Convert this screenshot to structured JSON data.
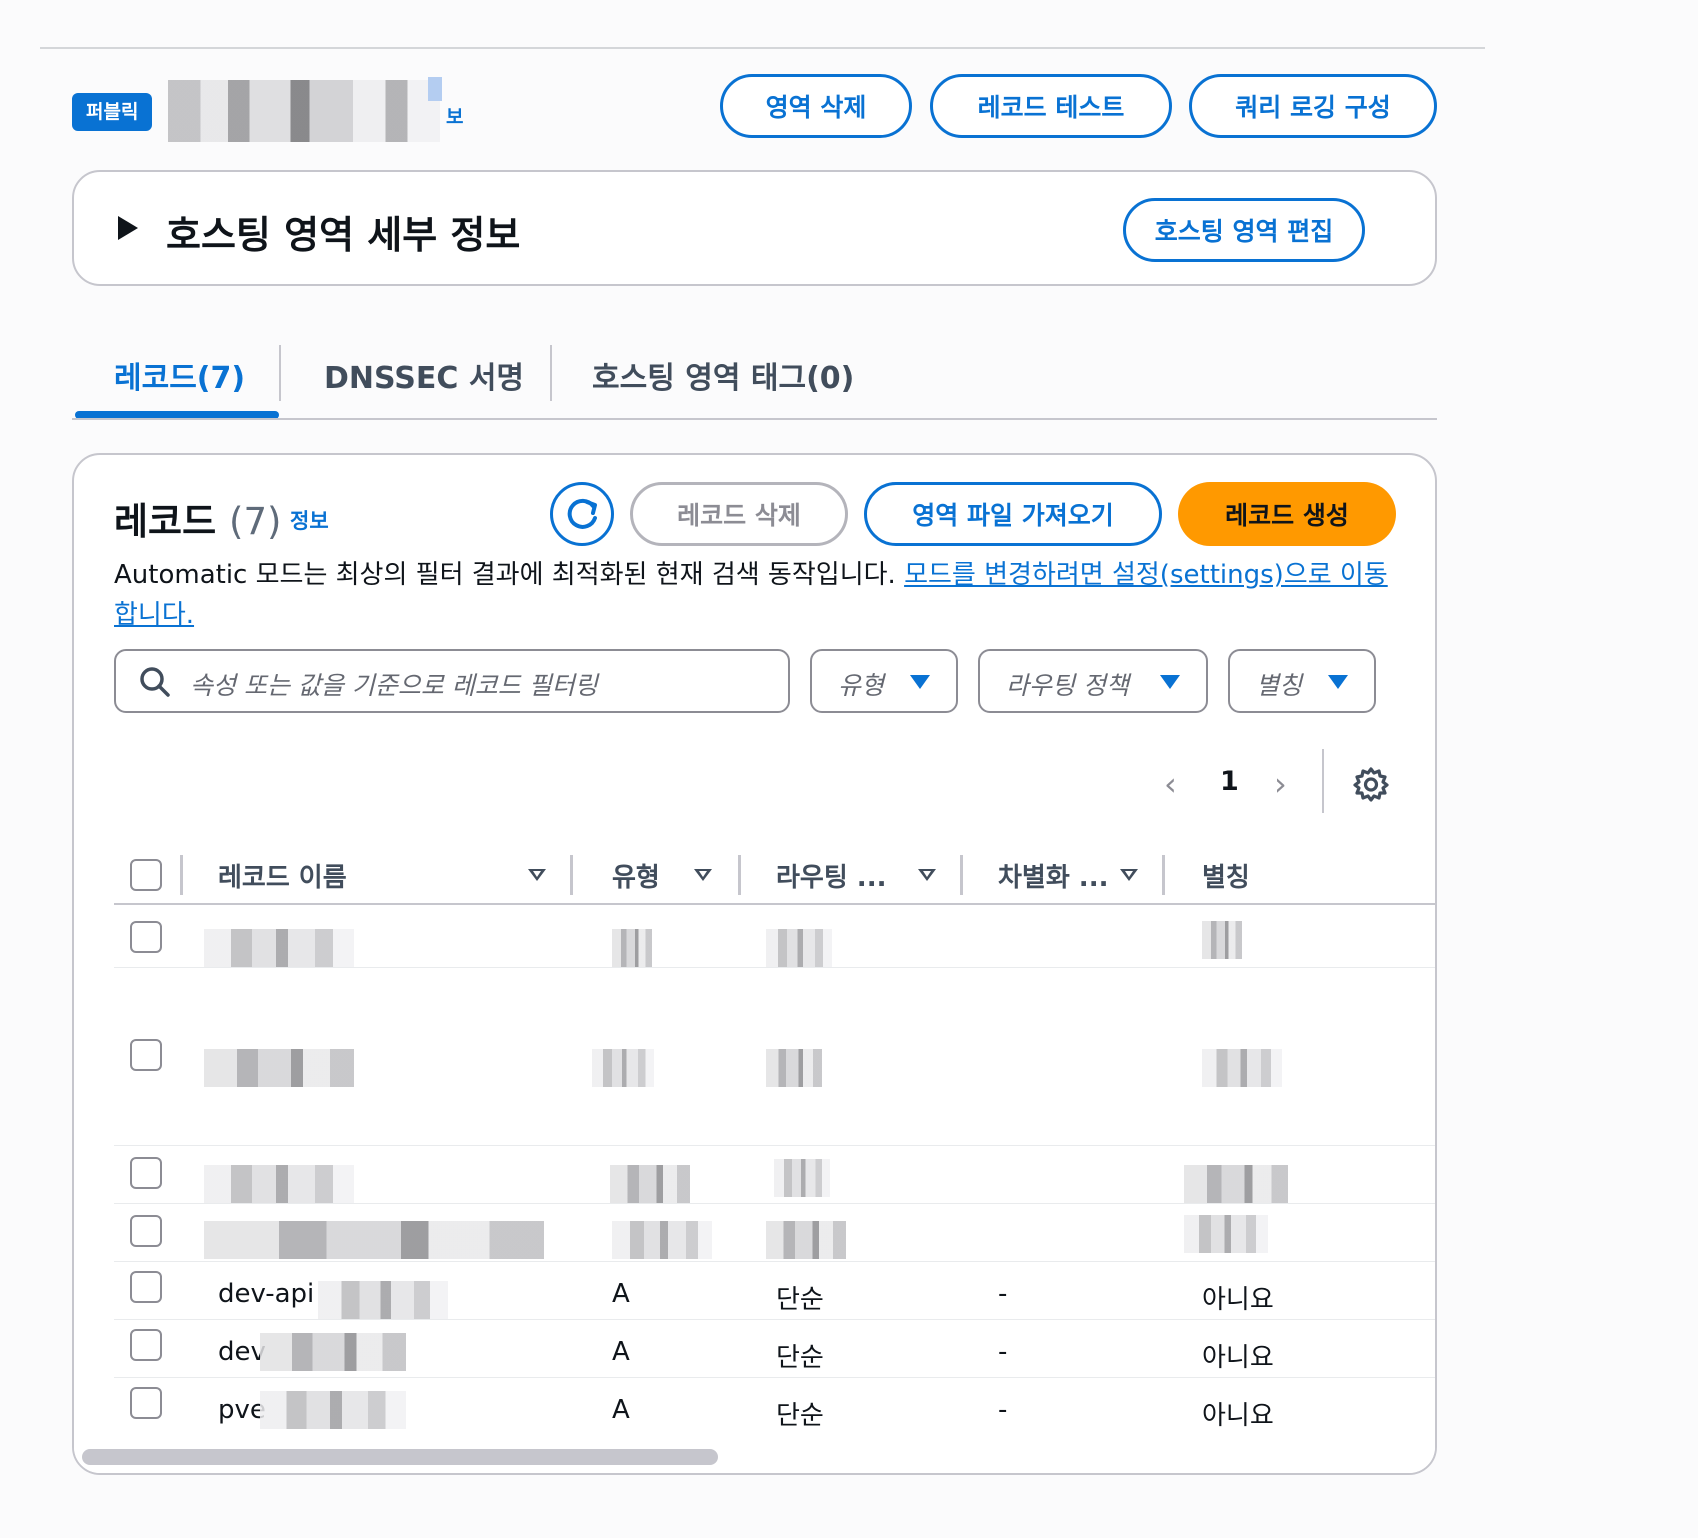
{
  "header": {
    "badge": "퍼블릭",
    "zone_name_suffix": "보",
    "buttons": {
      "delete_zone": "영역 삭제",
      "test_record": "레코드 테스트",
      "query_logging": "쿼리 로깅 구성"
    }
  },
  "details": {
    "title": "호스팅 영역 세부 정보",
    "edit_button": "호스팅 영역 편집"
  },
  "tabs": [
    {
      "label": "레코드(7)",
      "active": true
    },
    {
      "label": "DNSSEC 서명",
      "active": false
    },
    {
      "label": "호스팅 영역 태그(0)",
      "active": false
    }
  ],
  "records": {
    "title": "레코드",
    "count": "(7)",
    "info": "정보",
    "delete_button": "레코드 삭제",
    "import_button": "영역 파일 가져오기",
    "create_button": "레코드 생성",
    "description": "Automatic 모드는 최상의 필터 결과에 최적화된 현재 검색 동작입니다. ",
    "description_link": "모드를 변경하려면 설정(settings)으로 이동합니다.",
    "search_placeholder": "속성 또는 값을 기준으로 레코드 필터링",
    "filters": [
      "유형",
      "라우팅 정책",
      "별칭"
    ],
    "pagination": {
      "prev": "‹",
      "page": "1",
      "next": "›"
    },
    "columns": [
      "레코드 이름",
      "유형",
      "라우팅 ...",
      "차별화 ...",
      "별칭"
    ],
    "rows": [
      {
        "name": "",
        "type": "",
        "routing": "",
        "diff": "",
        "alias": ""
      },
      {
        "name": "",
        "type": "",
        "routing": "",
        "diff": "",
        "alias": ""
      },
      {
        "name": "",
        "type": "",
        "routing": "",
        "diff": "",
        "alias": ""
      },
      {
        "name": "",
        "type": "",
        "routing": "",
        "diff": "",
        "alias": ""
      },
      {
        "name": "dev-api",
        "type": "A",
        "routing": "단순",
        "diff": "-",
        "alias": "아니요"
      },
      {
        "name": "dev",
        "type": "A",
        "routing": "단순",
        "diff": "-",
        "alias": "아니요"
      },
      {
        "name": "pve",
        "type": "A",
        "routing": "단순",
        "diff": "-",
        "alias": "아니요"
      }
    ]
  },
  "colors": {
    "primary": "#0972d3",
    "create": "#ff9900",
    "border": "#c6c6cd"
  }
}
